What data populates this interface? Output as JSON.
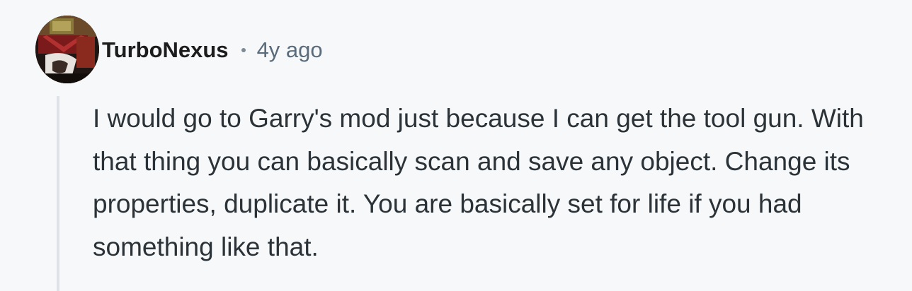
{
  "comment": {
    "author": "TurboNexus",
    "separator": "•",
    "timestamp": "4y ago",
    "body": "I would go to Garry's mod just because I can get the tool gun. With that thing you can basically scan and save any object. Change its properties, duplicate it. You are basically set for life if you had something like that.",
    "avatar_icon": "user-avatar-icon"
  },
  "colors": {
    "background": "#f7f8fa",
    "author": "#1c1c1c",
    "meta": "#5a6b7b",
    "body_text": "#2b3338",
    "thread_line": "#dfe3e8"
  }
}
